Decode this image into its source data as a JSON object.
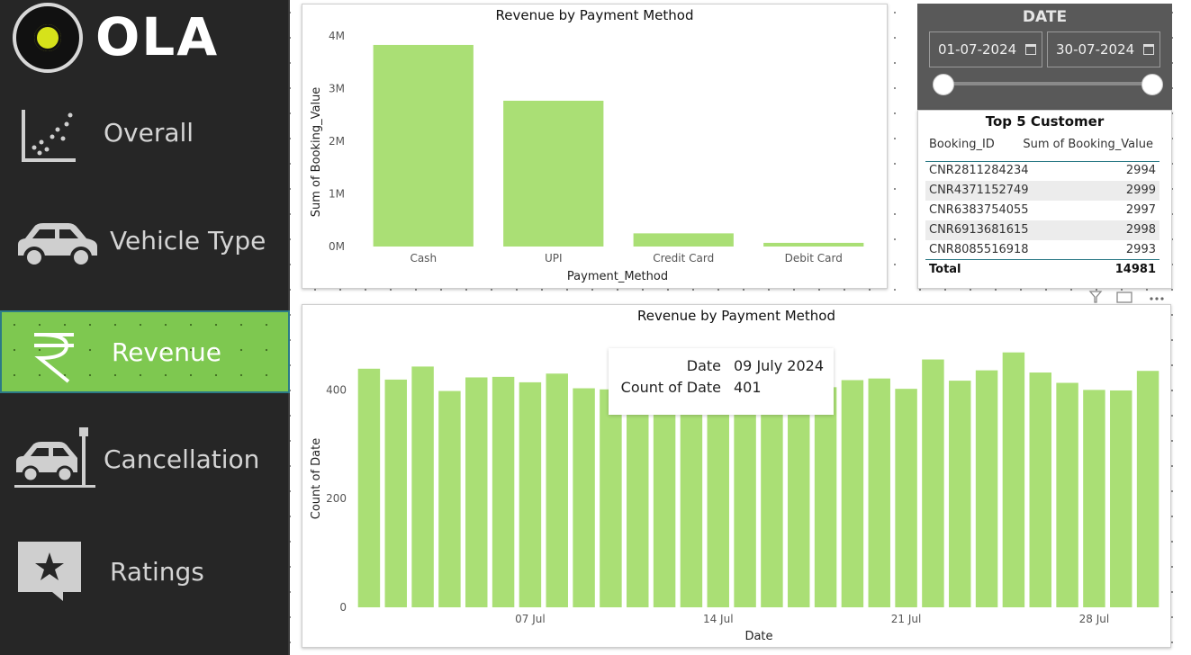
{
  "app": {
    "logo_text": "OLA"
  },
  "sidebar": {
    "items": [
      {
        "label": "Overall",
        "icon": "scatter-chart-icon",
        "active": false
      },
      {
        "label": "Vehicle Type",
        "icon": "car-icon",
        "active": false
      },
      {
        "label": "Revenue",
        "icon": "rupee-icon",
        "active": true
      },
      {
        "label": "Cancellation",
        "icon": "car-crash-icon",
        "active": false
      },
      {
        "label": "Ratings",
        "icon": "star-chat-icon",
        "active": false
      }
    ]
  },
  "date_slicer": {
    "title": "DATE",
    "start": "01-07-2024",
    "end": "30-07-2024",
    "range_fraction": [
      0,
      1
    ]
  },
  "top_customers": {
    "title": "Top 5 Customer",
    "columns": [
      "Booking_ID",
      "Sum of Booking_Value"
    ],
    "rows": [
      [
        "CNR2811284234",
        "2994"
      ],
      [
        "CNR4371152749",
        "2999"
      ],
      [
        "CNR6383754055",
        "2997"
      ],
      [
        "CNR6913681615",
        "2998"
      ],
      [
        "CNR8085516918",
        "2993"
      ]
    ],
    "total_label": "Total",
    "total_value": "14981"
  },
  "tooltip": {
    "date_label": "Date",
    "date_value": "09 July 2024",
    "count_label": "Count of Date",
    "count_value": "401"
  },
  "chart_data": [
    {
      "type": "bar",
      "title": "Revenue by Payment Method",
      "xlabel": "Payment_Method",
      "ylabel": "Sum of Booking_Value",
      "categories": [
        "Cash",
        "UPI",
        "Credit Card",
        "Debit Card"
      ],
      "values": [
        3830000,
        2770000,
        250000,
        70000
      ],
      "yticks": [
        "0M",
        "1M",
        "2M",
        "3M",
        "4M"
      ],
      "ylim": [
        0,
        4000000
      ],
      "color": "#aadf75"
    },
    {
      "type": "bar",
      "title": "Revenue by Payment Method",
      "xlabel": "Date",
      "ylabel": "Count of Date",
      "x": [
        "2024-07-01",
        "2024-07-02",
        "2024-07-03",
        "2024-07-04",
        "2024-07-05",
        "2024-07-06",
        "2024-07-07",
        "2024-07-08",
        "2024-07-09",
        "2024-07-10",
        "2024-07-11",
        "2024-07-12",
        "2024-07-13",
        "2024-07-14",
        "2024-07-15",
        "2024-07-16",
        "2024-07-17",
        "2024-07-18",
        "2024-07-19",
        "2024-07-20",
        "2024-07-21",
        "2024-07-22",
        "2024-07-23",
        "2024-07-24",
        "2024-07-25",
        "2024-07-26",
        "2024-07-27",
        "2024-07-28",
        "2024-07-29",
        "2024-07-30"
      ],
      "values": [
        439,
        419,
        443,
        398,
        423,
        424,
        414,
        430,
        403,
        401,
        400,
        405,
        402,
        399,
        398,
        400,
        403,
        405,
        418,
        421,
        402,
        456,
        417,
        436,
        469,
        432,
        413,
        400,
        399,
        435
      ],
      "xticks": [
        "07 Jul",
        "14 Jul",
        "21 Jul",
        "28 Jul"
      ],
      "yticks": [
        "0",
        "200",
        "400"
      ],
      "ylim": [
        0,
        490
      ],
      "color": "#aadf75"
    }
  ]
}
